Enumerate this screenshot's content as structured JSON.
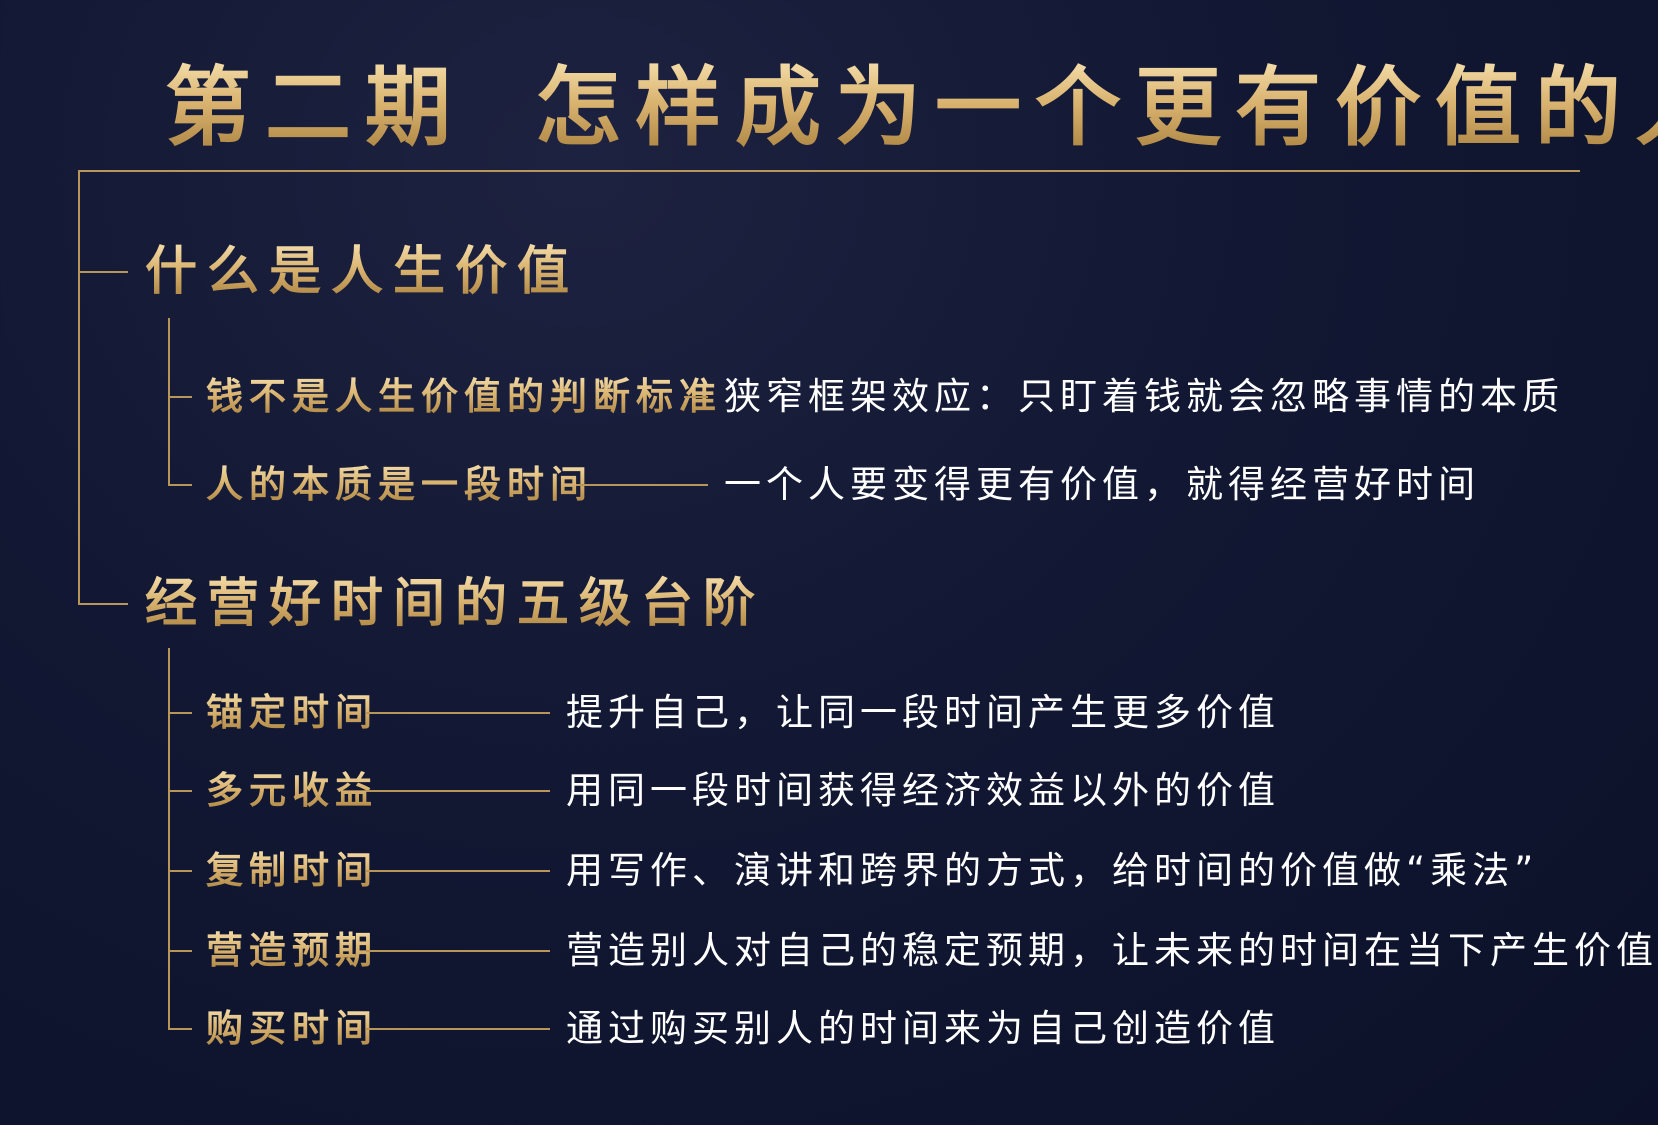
{
  "title": {
    "issue": "第二期",
    "text": "怎样成为一个更有价值的人"
  },
  "sections": [
    {
      "heading": "什么是人生价值",
      "items": [
        {
          "label": "钱不是人生价值的判断标准",
          "desc": "狭窄框架效应：只盯着钱就会忽略事情的本质"
        },
        {
          "label": "人的本质是一段时间",
          "desc": "一个人要变得更有价值，就得经营好时间"
        }
      ]
    },
    {
      "heading": "经营好时间的五级台阶",
      "items": [
        {
          "label": "锚定时间",
          "desc": "提升自己，让同一段时间产生更多价值"
        },
        {
          "label": "多元收益",
          "desc": "用同一段时间获得经济效益以外的价值"
        },
        {
          "label": "复制时间",
          "desc": "用写作、演讲和跨界的方式，给时间的价值做“乘法”"
        },
        {
          "label": "营造预期",
          "desc": "营造别人对自己的稳定预期，让未来的时间在当下产生价值"
        },
        {
          "label": "购买时间",
          "desc": "通过购买别人的时间来为自己创造价值"
        }
      ]
    }
  ],
  "colors": {
    "background": "#121833",
    "gold": "#d9b36f",
    "line": "#b8965a",
    "text": "#ffffff"
  }
}
